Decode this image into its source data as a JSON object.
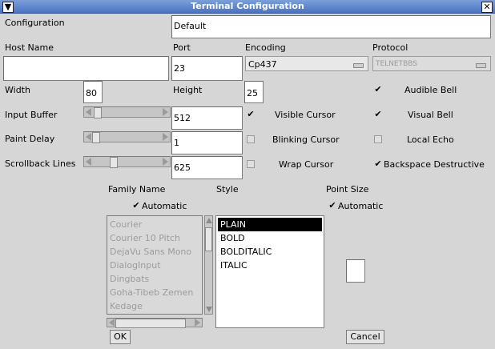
{
  "window": {
    "title": "Terminal Configuration",
    "menu_glyph": "▼",
    "close_glyph": "✕"
  },
  "configuration": {
    "label": "Configuration",
    "value": "Default"
  },
  "host": {
    "label": "Host Name",
    "value": ""
  },
  "port": {
    "label": "Port",
    "value": "23"
  },
  "encoding": {
    "label": "Encoding",
    "value": "Cp437"
  },
  "protocol": {
    "label": "Protocol",
    "value": "TELNETBBS"
  },
  "size": {
    "width_label": "Width",
    "width_value": "80",
    "height_label": "Height",
    "height_value": "25"
  },
  "input_buffer": {
    "label": "Input Buffer",
    "value": "512"
  },
  "paint_delay": {
    "label": "Paint Delay",
    "value": "1"
  },
  "scrollback": {
    "label": "Scrollback Lines",
    "value": "625"
  },
  "options": {
    "audible_bell": {
      "label": "Audible Bell",
      "checked": true
    },
    "visible_cursor": {
      "label": "Visible Cursor",
      "checked": true
    },
    "visual_bell": {
      "label": "Visual Bell",
      "checked": true
    },
    "blinking_cursor": {
      "label": "Blinking Cursor",
      "checked": false
    },
    "local_echo": {
      "label": "Local Echo",
      "checked": false
    },
    "wrap_cursor": {
      "label": "Wrap Cursor",
      "checked": false
    },
    "backspace_destructive": {
      "label": "Backspace Destructive",
      "checked": true
    }
  },
  "font": {
    "family_label": "Family Name",
    "style_label": "Style",
    "point_size_label": "Point Size",
    "family_automatic": {
      "label": "Automatic",
      "checked": true
    },
    "size_automatic": {
      "label": "Automatic",
      "checked": true
    },
    "families": [
      "Courier",
      "Courier 10 Pitch",
      "DejaVu Sans Mono",
      "DialogInput",
      "Dingbats",
      "Goha-Tibeb Zemen",
      "Kedage"
    ],
    "styles": [
      "PLAIN",
      "BOLD",
      "BOLDITALIC",
      "ITALIC"
    ],
    "selected_style": "PLAIN",
    "point_size_value": ""
  },
  "buttons": {
    "ok": "OK",
    "cancel": "Cancel"
  },
  "check_glyph": "✔"
}
